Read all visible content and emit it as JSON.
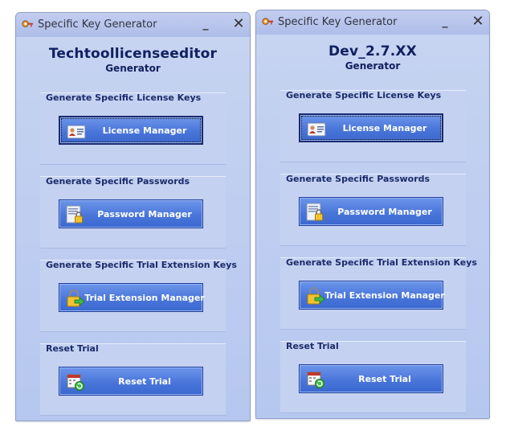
{
  "colors": {
    "window_bg": "#b6c7ef",
    "button_bg": "#4a76da",
    "header_text": "#102060"
  },
  "windows": [
    {
      "title": "Specific Key Generator",
      "heading": "Techtoollicenseeditor",
      "subheading": "Generator",
      "groups": [
        {
          "label": "Generate Specific License Keys",
          "button": "License Manager",
          "icon": "id-card-icon"
        },
        {
          "label": "Generate Specific Passwords",
          "button": "Password Manager",
          "icon": "password-lock-icon"
        },
        {
          "label": "Generate Specific Trial Extension Keys",
          "button": "Trial Extension Manager",
          "icon": "padlock-arrow-icon"
        },
        {
          "label": "Reset Trial",
          "button": "Reset Trial",
          "icon": "calendar-refresh-icon"
        }
      ]
    },
    {
      "title": "Specific Key Generator",
      "heading": "Dev_2.7.XX",
      "subheading": "Generator",
      "groups": [
        {
          "label": "Generate Specific License Keys",
          "button": "License Manager",
          "icon": "id-card-icon"
        },
        {
          "label": "Generate Specific Passwords",
          "button": "Password Manager",
          "icon": "password-lock-icon"
        },
        {
          "label": "Generate Specific Trial Extension Keys",
          "button": "Trial Extension Manager",
          "icon": "padlock-arrow-icon"
        },
        {
          "label": "Reset Trial",
          "button": "Reset Trial",
          "icon": "calendar-refresh-icon"
        }
      ]
    }
  ]
}
